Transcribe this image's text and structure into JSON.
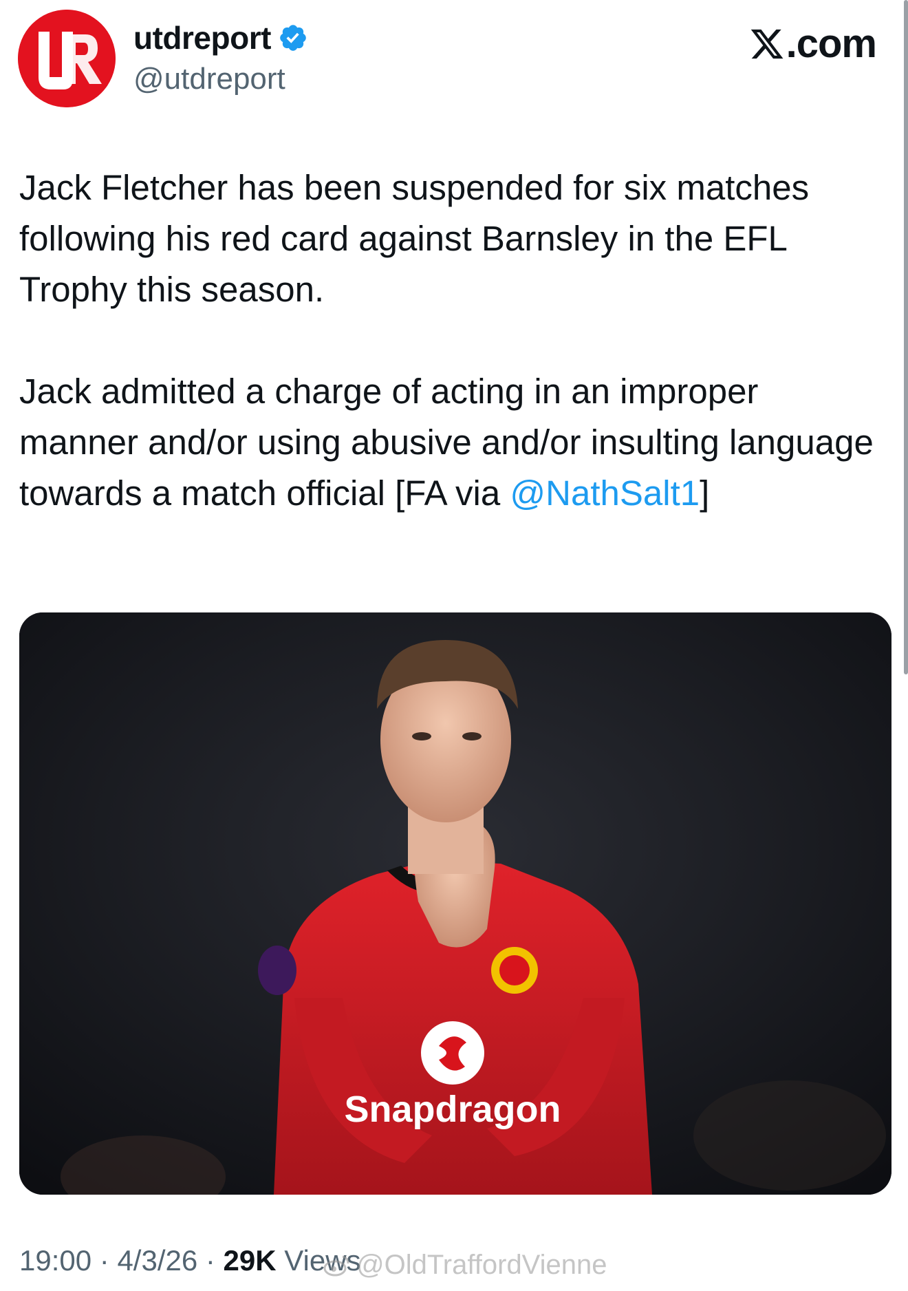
{
  "author": {
    "display_name": "utdreport",
    "handle": "@utdreport",
    "verified": true,
    "avatar_icon": "utdreport-logo-icon"
  },
  "brand": {
    "text": ".com",
    "icon": "x-logo-icon"
  },
  "tweet": {
    "paragraph1": "Jack Fletcher has been suspended for six matches following his red card against Barnsley in the EFL Trophy this season.",
    "paragraph2_text": "Jack admitted a charge of acting in an improper manner and/or using abusive and/or insulting language towards a match official [FA via ",
    "paragraph2_mention": "@NathSalt1",
    "paragraph2_end": "]"
  },
  "media": {
    "sponsor_text": "Snapdragon"
  },
  "meta": {
    "time": "19:00",
    "date": "4/3/26",
    "separator": " · ",
    "views_count": "29K",
    "views_label": "Views"
  },
  "watermark": {
    "text": "@OldTraffordVienne",
    "icon": "weibo-icon"
  },
  "colors": {
    "mention": "#1d9bf0",
    "secondary_text": "#536471",
    "avatar_red": "#e3121f",
    "verified_blue": "#1d9bf0"
  }
}
